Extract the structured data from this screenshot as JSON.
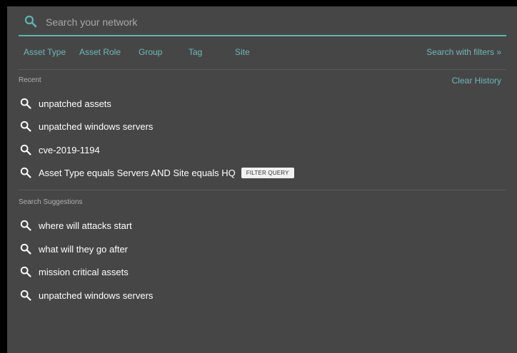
{
  "search": {
    "placeholder": "Search your network"
  },
  "filters": {
    "items": [
      "Asset Type",
      "Asset Role",
      "Group",
      "Tag",
      "Site"
    ],
    "advanced_link": "Search with filters »"
  },
  "recent": {
    "title": "Recent",
    "clear_label": "Clear History",
    "items": [
      "unpatched assets",
      "unpatched windows servers",
      "cve-2019-1194",
      "Asset Type equals Servers AND Site equals HQ"
    ],
    "badge": "FILTER QUERY"
  },
  "suggestions": {
    "title": "Search Suggestions",
    "items": [
      "where will attacks start",
      "what will they go after",
      "mission critical assets",
      "unpatched windows servers"
    ]
  },
  "colors": {
    "accent": "#5fb3b3",
    "panel": "#464646",
    "background": "#000000"
  },
  "icons": {
    "search": "search-icon"
  }
}
